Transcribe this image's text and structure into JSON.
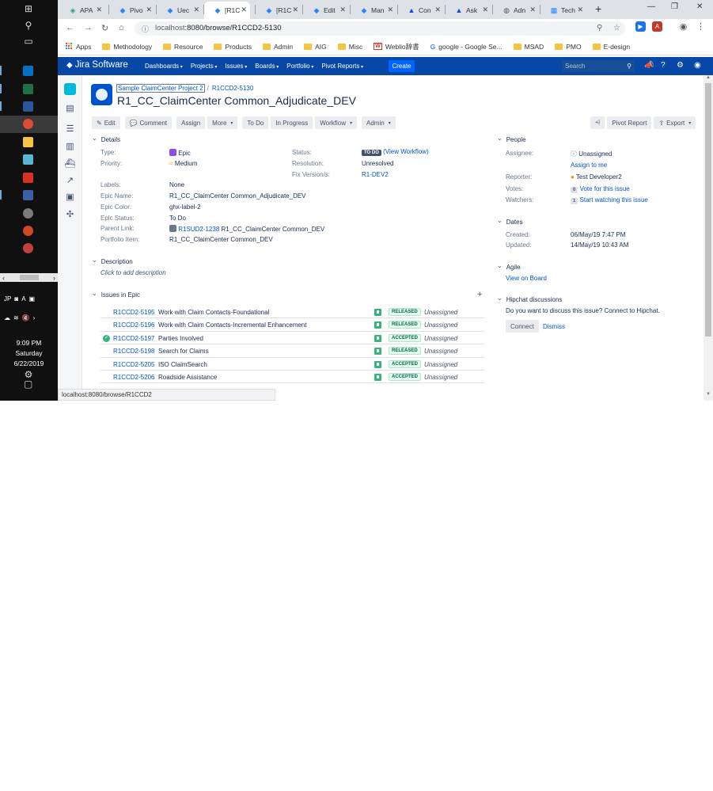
{
  "taskbar": {
    "lang": "JP",
    "clock_time": "9:09 PM",
    "clock_day": "Saturday",
    "clock_date": "6/22/2019"
  },
  "browser": {
    "tabs": [
      {
        "label": "APA",
        "icon": "jira-apa-icon"
      },
      {
        "label": "Pivo",
        "icon": "jira-diamond-icon"
      },
      {
        "label": "Uec",
        "icon": "jira-diamond-icon"
      },
      {
        "label": "[R1C",
        "icon": "jira-diamond-icon"
      },
      {
        "label": "[R1C",
        "icon": "jira-diamond-icon"
      },
      {
        "label": "Edit",
        "icon": "jira-diamond-icon"
      },
      {
        "label": "Man",
        "icon": "jira-diamond-icon"
      },
      {
        "label": "Con",
        "icon": "atlassian-icon"
      },
      {
        "label": "Ask",
        "icon": "atlassian-icon"
      },
      {
        "label": "Adn",
        "icon": "globe-icon"
      },
      {
        "label": "Tech",
        "icon": "jira-board-icon"
      }
    ],
    "active_tab_index": 3,
    "url_host": "localhost",
    "url_path": ":8080/browse/R1CCD2-5130",
    "bookmarks": [
      {
        "label": "Apps"
      },
      {
        "label": "Methodology"
      },
      {
        "label": "Resource"
      },
      {
        "label": "Products"
      },
      {
        "label": "Admin"
      },
      {
        "label": "AIG"
      },
      {
        "label": "Misc"
      },
      {
        "label": "Weblio辞書"
      },
      {
        "label": "google - Google Se..."
      },
      {
        "label": "MSAD"
      },
      {
        "label": "PMO"
      },
      {
        "label": "E-design"
      }
    ],
    "status_url": "localhost:8080/browse/R1CCD2"
  },
  "jira": {
    "brand": "Jira Software",
    "nav": [
      "Dashboards",
      "Projects",
      "Issues",
      "Boards",
      "Portfolio",
      "Pivot Reports"
    ],
    "create": "Create",
    "search_placeholder": "Search",
    "breadcrumb_project": "Sample ClaimCenter Project 2",
    "breadcrumb_key": "R1CCD2-5130",
    "title": "R1_CC_ClaimCenter Common_Adjudicate_DEV",
    "actions": {
      "edit": "Edit",
      "comment": "Comment",
      "assign": "Assign",
      "more": "More",
      "todo": "To Do",
      "in_progress": "In Progress",
      "workflow": "Workflow",
      "admin": "Admin",
      "pivot_report": "Pivot Report",
      "export": "Export"
    },
    "details": {
      "header": "Details",
      "type_label": "Type:",
      "type_value": "Epic",
      "priority_label": "Priority:",
      "priority_value": "Medium",
      "labels_label": "Labels:",
      "labels_value": "None",
      "status_label": "Status:",
      "status_value": "TO DO",
      "status_link": "(View Workflow)",
      "resolution_label": "Resolution:",
      "resolution_value": "Unresolved",
      "fixversion_label": "Fix Version/s:",
      "fixversion_value": "R1-DEV2",
      "epicname_label": "Epic Name:",
      "epicname_value": "R1_CC_ClaimCenter Common_Adjudicate_DEV",
      "epiccolor_label": "Epic Color:",
      "epiccolor_value": "ghx-label-2",
      "epicstatus_label": "Epic Status:",
      "epicstatus_value": "To Do",
      "parentlink_label": "Parent Link:",
      "parentlink_key": "R1SUD2-1238",
      "parentlink_name": "R1_CC_ClaimCenter Common_DEV",
      "portfolio_label": "Portfolio Item:",
      "portfolio_value": "R1_CC_ClaimCenter Common_DEV"
    },
    "description": {
      "header": "Description",
      "placeholder": "Click to add description"
    },
    "epic_issues": {
      "header": "Issues in Epic",
      "rows": [
        {
          "key": "R1CCD2-5195",
          "summary": "Work with Claim Contacts-Foundational",
          "status": "RELEASED",
          "assignee": "Unassigned",
          "done": false
        },
        {
          "key": "R1CCD2-5196",
          "summary": "Work with Claim Contacts-Incremental Enhancement",
          "status": "RELEASED",
          "assignee": "Unassigned",
          "done": false
        },
        {
          "key": "R1CCD2-5197",
          "summary": "Parties Involved",
          "status": "ACCEPTED",
          "assignee": "Unassigned",
          "done": true
        },
        {
          "key": "R1CCD2-5198",
          "summary": "Search for Claims",
          "status": "RELEASED",
          "assignee": "Unassigned",
          "done": false
        },
        {
          "key": "R1CCD2-5205",
          "summary": "ISO ClaimSearch",
          "status": "ACCEPTED",
          "assignee": "Unassigned",
          "done": false
        },
        {
          "key": "R1CCD2-5206",
          "summary": "Roadside Assistance",
          "status": "ACCEPTED",
          "assignee": "Unassigned",
          "done": false
        }
      ]
    },
    "people": {
      "header": "People",
      "assignee_label": "Assignee:",
      "assignee_value": "Unassigned",
      "assign_to_me": "Assign to me",
      "reporter_label": "Reporter:",
      "reporter_value": "Test Developer2",
      "votes_label": "Votes:",
      "votes_count": "0",
      "votes_link": "Vote for this issue",
      "watchers_label": "Watchers:",
      "watchers_count": "1",
      "watchers_link": "Start watching this issue"
    },
    "dates": {
      "header": "Dates",
      "created_label": "Created:",
      "created_value": "06/May/19 7:47 PM",
      "updated_label": "Updated:",
      "updated_value": "14/May/19 10:43 AM"
    },
    "agile": {
      "header": "Agile",
      "link": "View on Board"
    },
    "hipchat": {
      "header": "Hipchat discussions",
      "text": "Do you want to discuss this issue? Connect to Hipchat.",
      "connect": "Connect",
      "dismiss": "Dismiss"
    }
  }
}
